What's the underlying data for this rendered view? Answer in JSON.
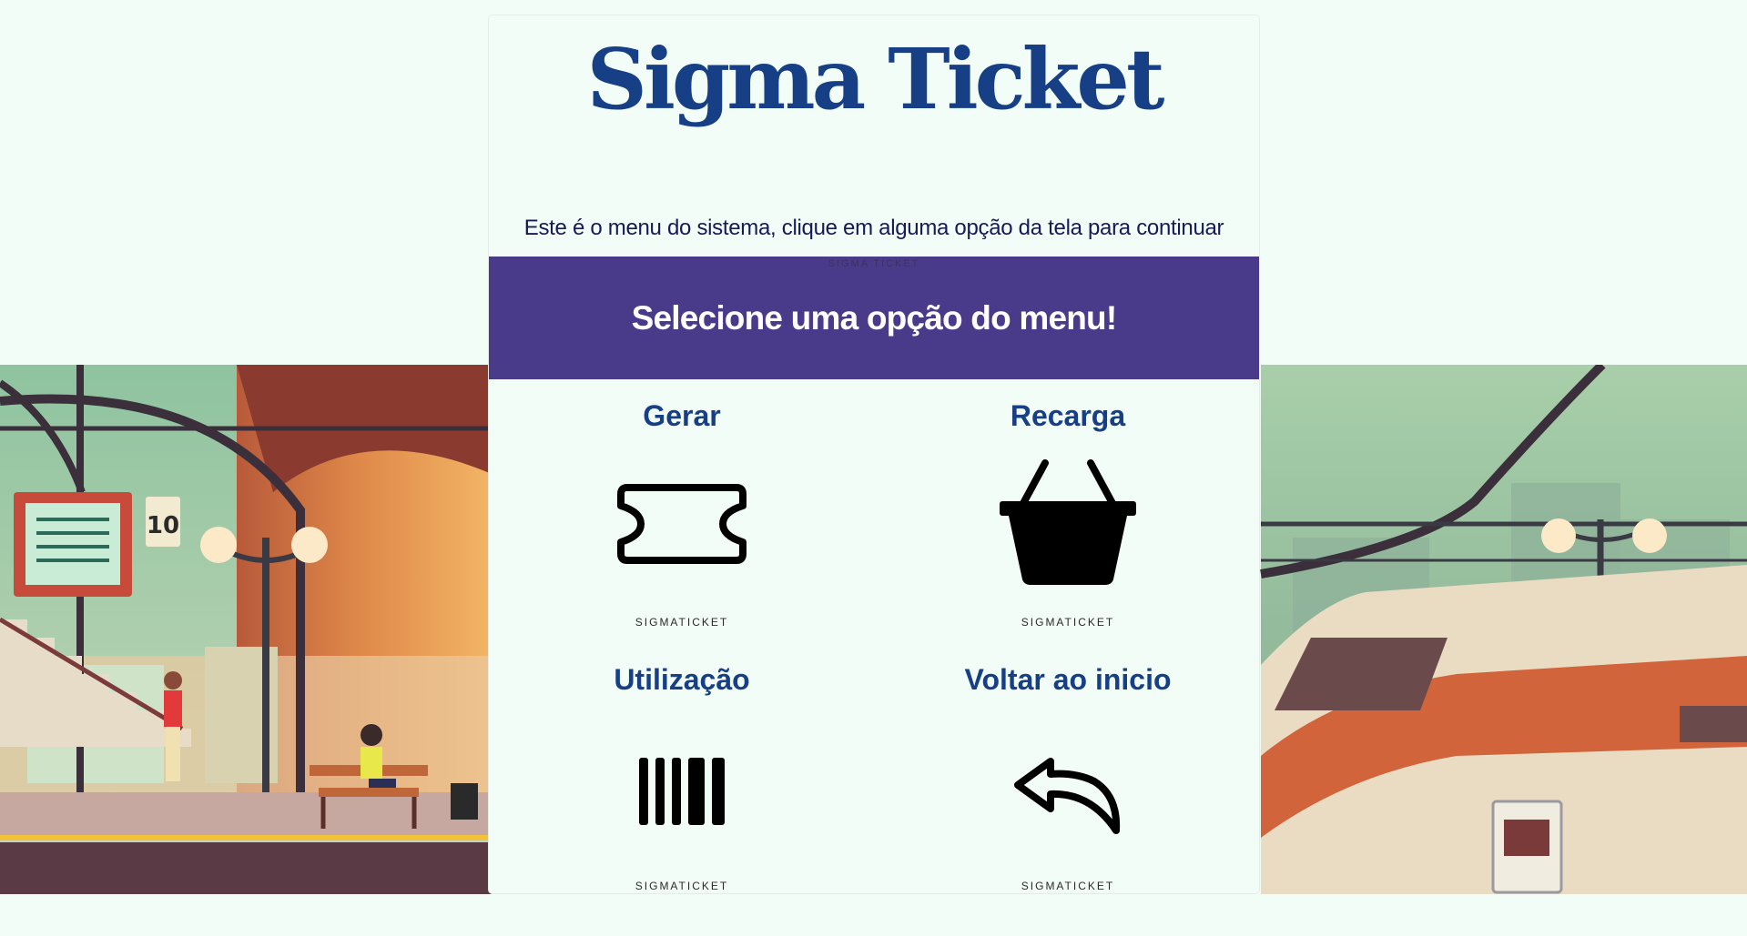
{
  "header": {
    "brand": "Sigma Ticket",
    "intro": "Este é o menu do sistema, clique em alguma opção da tela para continuar"
  },
  "banner": {
    "caption": "SIGMA TICKET",
    "title": "Selecione uma opção do menu!"
  },
  "menu": {
    "items": [
      {
        "label": "Gerar",
        "caption": "SIGMATICKET",
        "icon": "ticket-icon"
      },
      {
        "label": "Recarga",
        "caption": "SIGMATICKET",
        "icon": "basket-icon"
      },
      {
        "label": "Utilização",
        "caption": "SIGMATICKET",
        "icon": "barcode-icon"
      },
      {
        "label": "Voltar ao inicio",
        "caption": "SIGMATICKET",
        "icon": "reply-arrow-icon"
      }
    ]
  },
  "platform_sign": "10",
  "colors": {
    "brand": "#163f86",
    "banner": "#4a3b8a",
    "page_background": "#f3fdf8",
    "intro_text": "#161a55"
  }
}
